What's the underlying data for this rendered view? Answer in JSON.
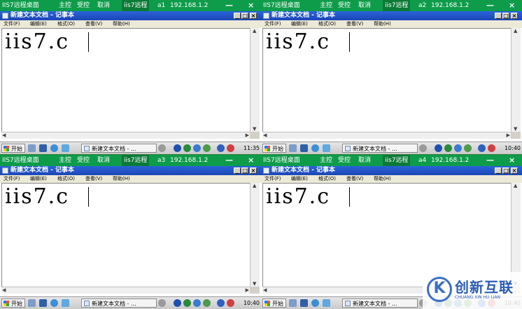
{
  "remote_bar": {
    "app_name": "IIS7远程桌面",
    "host_label": "主控",
    "controlled_label": "受控",
    "cancel_label": "取消",
    "close_glyph": "×",
    "sessions": [
      {
        "name": "iis7远程",
        "id": "a1",
        "ip": "192.168.1.2"
      },
      {
        "name": "iis7远程",
        "id": "a2",
        "ip": "192.168.1.2"
      },
      {
        "name": "iis7远程",
        "id": "a3",
        "ip": "192.168.1.2"
      },
      {
        "name": "iis7远程",
        "id": "a4",
        "ip": "192.168.1.2"
      }
    ]
  },
  "notepad": {
    "title": "新建文本文档 - 记事本",
    "menu": [
      "文件(F)",
      "编辑(E)",
      "格式(O)",
      "查看(V)",
      "帮助(H)"
    ],
    "content": "iis7.c"
  },
  "taskbar": {
    "start_label": "开始",
    "task_button": "新建文本文档 - ...",
    "clocks": [
      "11:35",
      "10:40",
      "10:40",
      "10:40"
    ]
  },
  "watermark": {
    "mark": "K",
    "brand": "创新互联",
    "sub": "CHUANG XIN HU LIAN"
  },
  "colors": {
    "remote_bar": "#0e9c4a",
    "titlebar": "#1b46b5",
    "menubar": "#ece9d8"
  }
}
